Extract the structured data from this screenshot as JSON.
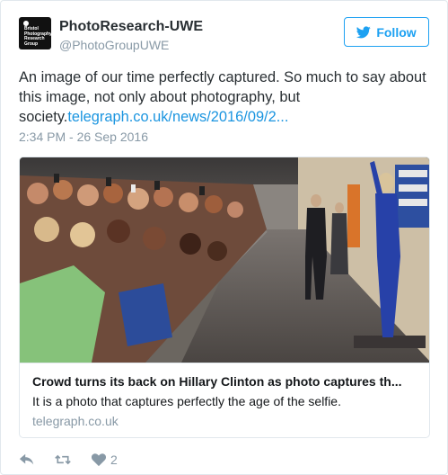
{
  "account": {
    "name": "PhotoResearch-UWE",
    "handle": "@PhotoGroupUWE",
    "avatar_text": "Bristol Photography Research Group"
  },
  "follow_button": {
    "label": "Follow",
    "icon": "bird-icon"
  },
  "tweet": {
    "text": "An image of our time perfectly captured. So much to say about this image, not only about photography, but society.",
    "link": "telegraph.co.uk/news/2016/09/2...",
    "timestamp": "2:34 PM - 26 Sep 2016"
  },
  "card": {
    "title": "Crowd turns its back on Hillary Clinton as photo captures th...",
    "description": "It is a photo that captures perfectly the age of the selfie.",
    "domain": "telegraph.co.uk"
  },
  "actions": {
    "reply_icon": "reply-icon",
    "retweet_icon": "retweet-icon",
    "like_icon": "heart-icon",
    "like_count": "2"
  },
  "colors": {
    "accent": "#1da1f2",
    "link": "#1b95e0",
    "muted": "#8899a6"
  }
}
